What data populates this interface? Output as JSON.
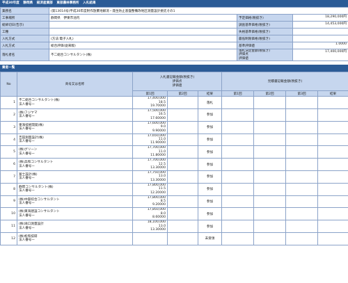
{
  "header": {
    "year": "平成30年度",
    "office": "静岡県",
    "bureau": "経済産業部",
    "section": "東部農林事務所",
    "doc": "入札結果"
  },
  "summary": {
    "rows": [
      {
        "l1": "業務名",
        "v1": "(第13014号)平成30年度附作放棄地解消・発生防止基盤整備改地区測量設計委託その1",
        "l2": "",
        "v2": ""
      },
      {
        "l1": "工事場所",
        "v1": "静岡県　伊東市池内",
        "l2": "予定価格(税抜き)",
        "v2": "18,290,000円"
      },
      {
        "l1": "総締切日(告示)",
        "v1": "",
        "l2": "調査基準価格(税抜き)",
        "v2": "14,453,000円"
      },
      {
        "l1": "工種",
        "v1": "",
        "l2": "失格基準価格(税抜き)",
        "v2": ""
      },
      {
        "l1": "入札方式",
        "v1": "(方法:電子入札)",
        "l2": "最低制限価格(税抜き)",
        "v2": ""
      },
      {
        "l1": "入札方式",
        "v1": "総合評価(従来版)",
        "l2": "基準評価値",
        "v2": "1.0000"
      },
      {
        "l1": "落札者名",
        "v1": "不二総合コンサルタント(株)",
        "l2": "落札決定金額(税抜き)\n評価点\n評価値",
        "v2": "17,400,000円"
      }
    ]
  },
  "list": {
    "title": "業者一覧",
    "headers": {
      "no": "No",
      "name": "商号又は名称",
      "bid_group": "入札書記載金額(税抜き)",
      "bid_sub1": "評価点",
      "bid_sub2": "評価値",
      "round1": "第1回",
      "round2": "第2回",
      "result": "結果",
      "lowprice_group": "見積書記載金額(税抜き)",
      "l1": "第1回",
      "l2": "第2回",
      "l3": "第3回",
      "l4": "結果"
    },
    "rows": [
      {
        "no": "1",
        "name": "不二総合コンサルタント(株)",
        "rep": "法人番号ー",
        "amount": "17,400,000",
        "score": "18.5",
        "value": "19.70000",
        "result": "落札"
      },
      {
        "no": "2",
        "name": "(株)フジヤマ",
        "rep": "法人番号ー",
        "amount": "17,500,000",
        "score": "16.5",
        "value": "17.60000",
        "result": "参加"
      },
      {
        "no": "3",
        "name": "東海技術開発(株)",
        "rep": "法人番号ー",
        "amount": "17,600,000",
        "score": "9.0",
        "value": "9.90000",
        "result": "参加"
      },
      {
        "no": "4",
        "name": "吉田測量設計(株)",
        "rep": "法人番号ー",
        "amount": "17,650,000",
        "score": "11.0",
        "value": "11.90000",
        "result": "参加"
      },
      {
        "no": "5",
        "name": "(株)グリーン",
        "rep": "法人番号ー",
        "amount": "17,700,000",
        "score": "11.0",
        "value": "11.80000",
        "result": "参加"
      },
      {
        "no": "6",
        "name": "(株)兵和コンサルタント",
        "rep": "法人番号ー",
        "amount": "17,700,000",
        "score": "12.5",
        "value": "13.30000",
        "result": "参加"
      },
      {
        "no": "7",
        "name": "富士設計(株)",
        "rep": "法人番号ー",
        "amount": "17,750,000",
        "score": "13.0",
        "value": "13.30000",
        "result": "参加"
      },
      {
        "no": "8",
        "name": "静岡コンサルタント(株)",
        "rep": "法人番号ー",
        "amount": "17,800,000",
        "score": "11.5",
        "value": "12.20000",
        "result": "参加"
      },
      {
        "no": "9",
        "name": "(株)中部綜合コンサルタント",
        "rep": "法人番号ー",
        "amount": "17,800,000",
        "score": "8.5",
        "value": "9.20000",
        "result": "参加"
      },
      {
        "no": "10",
        "name": "(株)東海建設コンサルタント",
        "rep": "法人番号ー",
        "amount": "17,850,000",
        "score": "8.0",
        "value": "8.60000",
        "result": "参加"
      },
      {
        "no": "11",
        "name": "(株)滝口測量設計",
        "rep": "法人番号ー",
        "amount": "18,100,000",
        "score": "13.0",
        "value": "13.30000",
        "result": "参加"
      },
      {
        "no": "12",
        "name": "(株)松和技研",
        "rep": "法人番号ー",
        "amount": "",
        "score": "",
        "value": "",
        "result": "未受領"
      }
    ]
  }
}
